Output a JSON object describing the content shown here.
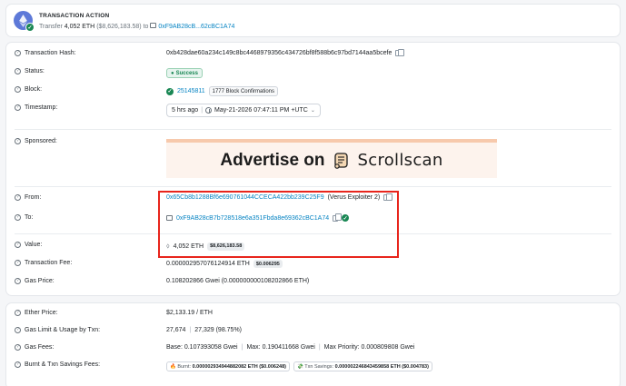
{
  "action": {
    "title": "TRANSACTION ACTION",
    "verb": "Transfer",
    "amount": "4,052 ETH",
    "usd": "($8,626,183.58)",
    "to_word": "to",
    "address": "0xF9AB28cB...62cBC1A74"
  },
  "details": {
    "hash": {
      "label": "Transaction Hash:",
      "value": "0xb428dae60a234c149c8bc4468979356c434726bf8f588b6c97bd7144aa5bcefe"
    },
    "status": {
      "label": "Status:",
      "value": "Success"
    },
    "block": {
      "label": "Block:",
      "value": "25145811",
      "confirmations": "1777 Block Confirmations"
    },
    "timestamp": {
      "label": "Timestamp:",
      "ago": "5 hrs ago",
      "date": "May-21-2026 07:47:11 PM +UTC"
    },
    "sponsored": {
      "label": "Sponsored:",
      "ad_text": "Advertise on",
      "ad_brand": "Scrollscan"
    },
    "from": {
      "label": "From:",
      "address": "0x65Cb8b1288Bf6e690761044CCECA422bb239C25F9",
      "tag": "(Verus Exploiter 2)"
    },
    "to": {
      "label": "To:",
      "address": "0xF9AB28cB7b728518e6a351Fbda8e69362cBC1A74"
    },
    "value": {
      "label": "Value:",
      "amount": "4,052 ETH",
      "usd": "$8,626,183.58"
    },
    "fee": {
      "label": "Transaction Fee:",
      "amount": "0.000002957076124914 ETH",
      "usd": "$0.006295"
    },
    "gas_price": {
      "label": "Gas Price:",
      "value": "0.108202866 Gwei (0.000000000108202866 ETH)"
    }
  },
  "more": {
    "ether_price": {
      "label": "Ether Price:",
      "value": "$2,133.19 / ETH"
    },
    "gas_limit": {
      "label": "Gas Limit & Usage by Txn:",
      "limit": "27,674",
      "usage": "27,329 (98.75%)"
    },
    "gas_fees": {
      "label": "Gas Fees:",
      "base": "Base: 0.107393058 Gwei",
      "max": "Max: 0.190411668 Gwei",
      "priority": "Max Priority: 0.000809808 Gwei"
    },
    "burnt": {
      "label": "Burnt & Txn Savings Fees:",
      "burnt_label": "🔥 Burnt:",
      "burnt_value": "0.000002934944882082 ETH ($0.006248)",
      "savings_label": "💸 Txn Savings:",
      "savings_value": "0.000002246843459858 ETH ($0.004783)"
    }
  },
  "colors": {
    "link": "#0784c3",
    "success": "#198754",
    "highlight": "#e8251c"
  }
}
